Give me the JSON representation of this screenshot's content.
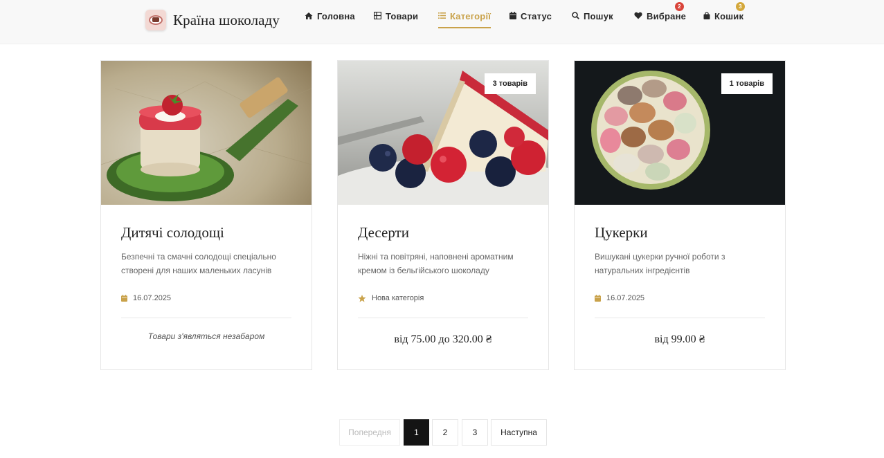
{
  "brand": {
    "name": "Країна шоколаду"
  },
  "nav": [
    {
      "label": "Головна",
      "icon": "home-icon"
    },
    {
      "label": "Товари",
      "icon": "grid-icon"
    },
    {
      "label": "Категорії",
      "icon": "list-icon",
      "active": true
    },
    {
      "label": "Статус",
      "icon": "calendar-icon"
    },
    {
      "label": "Пошук",
      "icon": "search-icon"
    },
    {
      "label": "Вибране",
      "icon": "heart-icon",
      "badge": "2"
    },
    {
      "label": "Кошик",
      "icon": "bag-icon",
      "badge": "3"
    }
  ],
  "colors": {
    "accent": "#c9a24a",
    "badge_red": "#d9443a",
    "badge_gold": "#d4a83b"
  },
  "cards": [
    {
      "title": "Дитячі солодощі",
      "description": "Безпечні та смачні солодощі спеціально створені для наших маленьких ласунів",
      "meta": "16.07.2025",
      "meta_icon": "calendar-icon",
      "footer": "Товари з'являться незабаром"
    },
    {
      "title": "Десерти",
      "count": "3 товарів",
      "description": "Ніжні та повітряні, наповнені ароматним кремом із бельгійського шоколаду",
      "meta": "Нова категорія",
      "meta_icon": "star-icon",
      "footer": "від 75.00 до 320.00 ₴"
    },
    {
      "title": "Цукерки",
      "count": "1 товарів",
      "description": "Вишукані цукерки ручної роботи з натуральних інгредієнтів",
      "meta": "16.07.2025",
      "meta_icon": "calendar-icon",
      "footer": "від 99.00 ₴"
    }
  ],
  "pagination": {
    "prev": "Попередня",
    "pages": [
      "1",
      "2",
      "3"
    ],
    "current": "1",
    "next": "Наступна"
  }
}
